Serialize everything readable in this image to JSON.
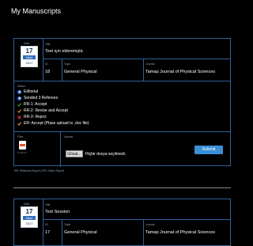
{
  "page_title": "My Manuscripts",
  "labels": {
    "date": "Date",
    "title": "Title",
    "id": "ID",
    "topic": "Topic",
    "journal": "Journal",
    "status": "Status",
    "files": "Files",
    "upload": "Upload"
  },
  "manuscripts": [
    {
      "date": {
        "day": "17",
        "month": "Mart",
        "year": "2017"
      },
      "title": "Test için eklenmiştir.",
      "id": "18",
      "topic": "General Physical",
      "journal": "Tamap Journal of Physical Sciences",
      "statuses": [
        {
          "icon": "dot-icon",
          "text": "Editorial"
        },
        {
          "icon": "dot-icon",
          "text": "Sended 3 Referees"
        },
        {
          "icon": "check-icon",
          "text": "RR-1: Accept",
          "color": "#37c24a"
        },
        {
          "icon": "check-icon",
          "text": "RR-2: Revise and Accept",
          "color": "#e8b43a"
        },
        {
          "icon": "cross-icon",
          "text": "RR-3: Reject",
          "color": "#e23a3a"
        },
        {
          "icon": "check-icon",
          "text": "ER: Accept (Plase upload to .doc file)",
          "color": "#e8b43a"
        }
      ],
      "file_caption": "17.03.17",
      "choose_label": "Gözat...",
      "no_file_text": "Hiçbir dosya seçilmedi.",
      "submit_label": "Submit",
      "footer_links": "RR: Referees Report | ER: Editor Report"
    },
    {
      "date": {
        "day": "17",
        "month": "Mart",
        "year": "2017"
      },
      "title": "Test Session",
      "id": "17",
      "topic": "General Physical",
      "journal": "Tamap Journal of Physical Sciences"
    }
  ],
  "colors": {
    "accent": "#2f5f96",
    "button": "#3a8fd6",
    "background": "#000000"
  }
}
